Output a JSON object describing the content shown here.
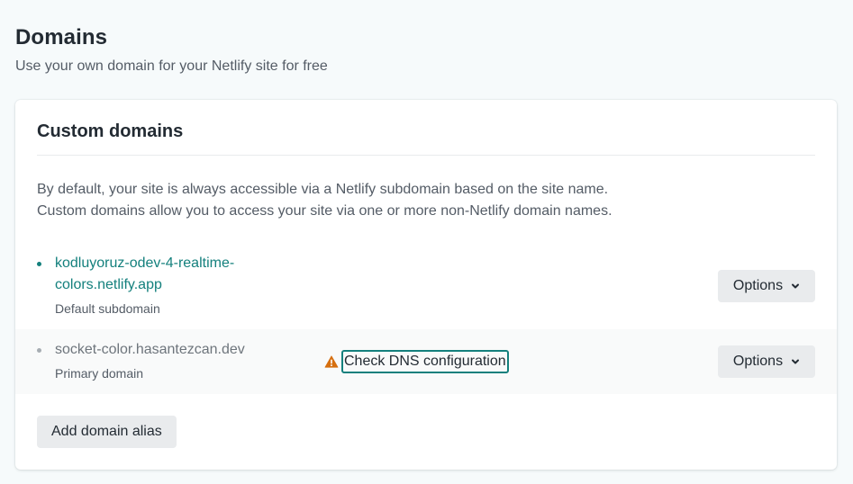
{
  "header": {
    "title": "Domains",
    "subtitle": "Use your own domain for your Netlify site for free"
  },
  "custom_domains": {
    "title": "Custom domains",
    "description_line1": "By default, your site is always accessible via a Netlify subdomain based on the site name.",
    "description_line2": "Custom domains allow you to access your site via one or more non-Netlify domain names.",
    "domains": [
      {
        "name": "kodluyoruz-odev-4-realtime-colors.netlify.app",
        "label": "Default subdomain",
        "options_label": "Options"
      },
      {
        "name": "socket-color.hasantezcan.dev",
        "label": "Primary domain",
        "warning_link": "Check DNS configuration",
        "options_label": "Options"
      }
    ],
    "add_button_label": "Add domain alias"
  },
  "icons": {
    "warning": "warning-triangle-icon",
    "chevron": "chevron-down-icon"
  },
  "colors": {
    "accent": "#14807d",
    "warning": "#d66f0f",
    "button_bg": "#e9ebed",
    "page_bg": "#f6fafb"
  }
}
